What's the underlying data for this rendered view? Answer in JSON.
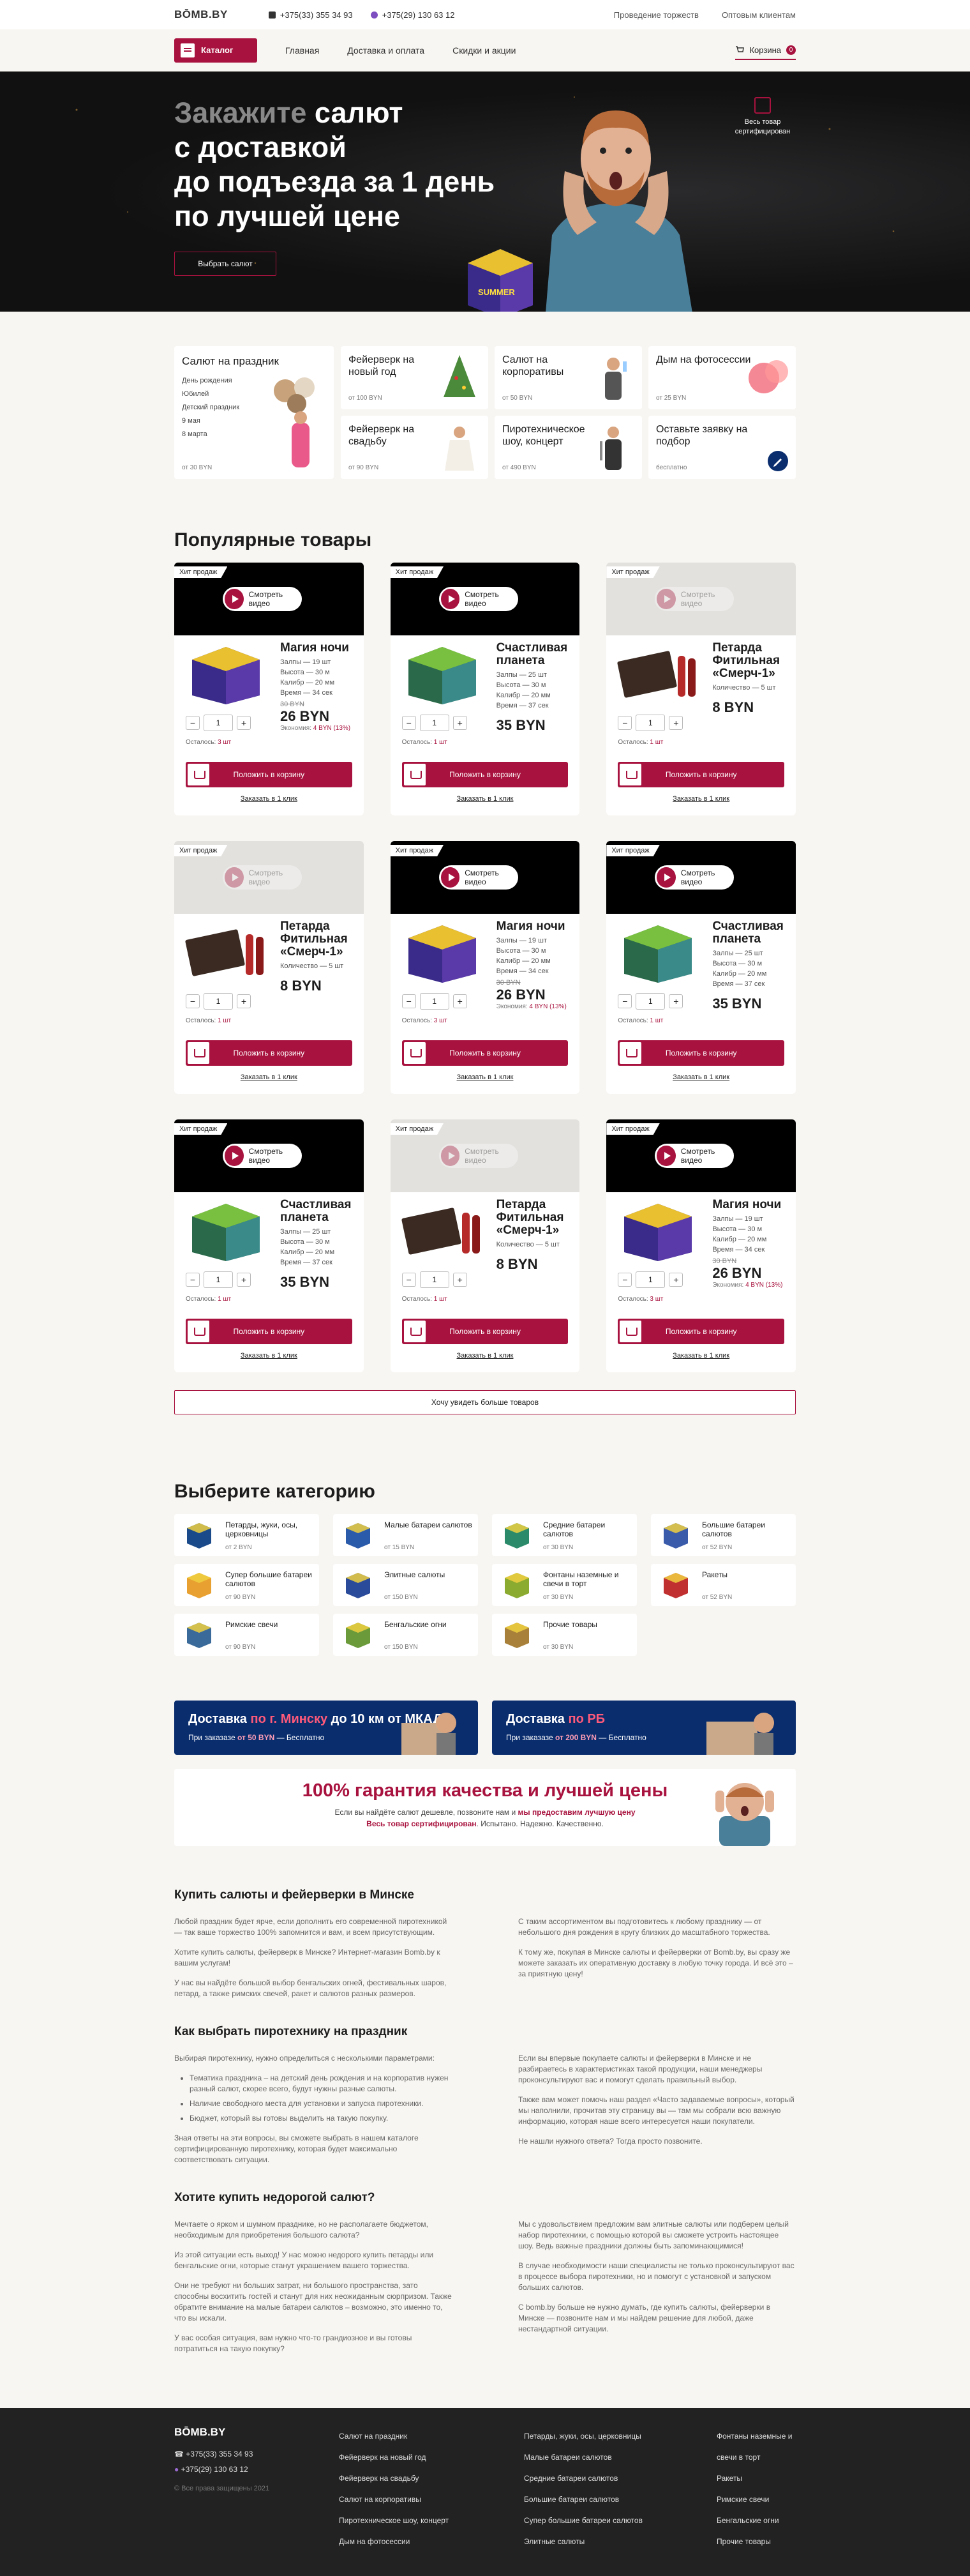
{
  "header": {
    "logo": "BŌMB.BY",
    "phone1": "+375(33) 355 34 93",
    "phone2": "+375(29) 130 63 12",
    "links": [
      "Проведение торжеств",
      "Оптовым клиентам"
    ]
  },
  "nav": {
    "catalog": "Каталог",
    "links": [
      "Главная",
      "Доставка и оплата",
      "Скидки и акции"
    ],
    "cart": "Корзина",
    "cart_count": "0"
  },
  "hero": {
    "title_grey": "Закажите",
    "title_rest": " салют",
    "line2": "с доставкой",
    "line3": "до подъезда за 1 день",
    "line4": "по лучшей цене",
    "button": "Выбрать салют",
    "cert": "Весь товар сертифицирован"
  },
  "occasions": {
    "big": {
      "title": "Салют на праздник",
      "items": [
        "День рождения",
        "Юбилей",
        "Детский праздник",
        "9 мая",
        "8 марта"
      ],
      "price": "от 30 BYN"
    },
    "cards": [
      {
        "title": "Фейерверк на новый год",
        "price": "от 100 BYN"
      },
      {
        "title": "Салют на корпоративы",
        "price": "от 50 BYN"
      },
      {
        "title": "Дым на фотосессии",
        "price": "от 25 BYN"
      },
      {
        "title": "Фейерверк на свадьбу",
        "price": "от 90 BYN"
      },
      {
        "title": "Пиротехническое шоу, концерт",
        "price": "от 490 BYN"
      },
      {
        "title": "Оставьте заявку на подбор",
        "price": "бесплатно"
      }
    ]
  },
  "popular": {
    "title": "Популярные товары",
    "hit": "Хит продаж",
    "video": "Смотреть видео",
    "left_label": "Осталось:",
    "add": "Положить в корзину",
    "oneclick": "Заказать в 1 клик",
    "qty": "1",
    "items": [
      {
        "name": "Магия ночи",
        "spec": [
          "Залпы — 19 шт",
          "Высота — 30 м",
          "Калибр — 20 мм",
          "Время — 34 сек"
        ],
        "old": "30 BYN",
        "price": "26 BYN",
        "econ_label": "Экономия:",
        "econ": "4 BYN (13%)",
        "left": "3 шт",
        "video": "dark"
      },
      {
        "name": "Счастливая планета",
        "spec": [
          "Залпы — 25 шт",
          "Высота — 30 м",
          "Калибр — 20 мм",
          "Время — 37 сек"
        ],
        "old": "",
        "price": "35 BYN",
        "econ_label": "",
        "econ": "",
        "left": "1 шт",
        "video": "dark"
      },
      {
        "name": "Петарда Фитильная «Смерч-1»",
        "spec": [
          "Количество — 5 шт"
        ],
        "old": "",
        "price": "8 BYN",
        "econ_label": "",
        "econ": "",
        "left": "1 шт",
        "video": "grey"
      },
      {
        "name": "Петарда Фитильная «Смерч-1»",
        "spec": [
          "Количество — 5 шт"
        ],
        "old": "",
        "price": "8 BYN",
        "econ_label": "",
        "econ": "",
        "left": "1 шт",
        "video": "grey"
      },
      {
        "name": "Магия ночи",
        "spec": [
          "Залпы — 19 шт",
          "Высота — 30 м",
          "Калибр — 20 мм",
          "Время — 34 сек"
        ],
        "old": "30 BYN",
        "price": "26 BYN",
        "econ_label": "Экономия:",
        "econ": "4 BYN (13%)",
        "left": "3 шт",
        "video": "dark"
      },
      {
        "name": "Счастливая планета",
        "spec": [
          "Залпы — 25 шт",
          "Высота — 30 м",
          "Калибр — 20 мм",
          "Время — 37 сек"
        ],
        "old": "",
        "price": "35 BYN",
        "econ_label": "",
        "econ": "",
        "left": "1 шт",
        "video": "dark"
      },
      {
        "name": "Счастливая планета",
        "spec": [
          "Залпы — 25 шт",
          "Высота — 30 м",
          "Калибр — 20 мм",
          "Время — 37 сек"
        ],
        "old": "",
        "price": "35 BYN",
        "econ_label": "",
        "econ": "",
        "left": "1 шт",
        "video": "dark"
      },
      {
        "name": "Петарда Фитильная «Смерч-1»",
        "spec": [
          "Количество — 5 шт"
        ],
        "old": "",
        "price": "8 BYN",
        "econ_label": "",
        "econ": "",
        "left": "1 шт",
        "video": "grey"
      },
      {
        "name": "Магия ночи",
        "spec": [
          "Залпы — 19 шт",
          "Высота — 30 м",
          "Калибр — 20 мм",
          "Время — 34 сек"
        ],
        "old": "30 BYN",
        "price": "26 BYN",
        "econ_label": "Экономия:",
        "econ": "4 BYN (13%)",
        "left": "3 шт",
        "video": "dark"
      }
    ],
    "more": "Хочу увидеть больше товаров"
  },
  "categories": {
    "title": "Выберите категорию",
    "items": [
      {
        "title": "Петарды, жуки, осы, церковницы",
        "price": "от 2 BYN"
      },
      {
        "title": "Малые батареи салютов",
        "price": "от 15 BYN"
      },
      {
        "title": "Средние батареи салютов",
        "price": "от 30 BYN"
      },
      {
        "title": "Большие батареи салютов",
        "price": "от 52 BYN"
      },
      {
        "title": "Супер большие батареи салютов",
        "price": "от 90 BYN"
      },
      {
        "title": "Элитные салюты",
        "price": "от 150 BYN"
      },
      {
        "title": "Фонтаны наземные и свечи в торт",
        "price": "от 30 BYN"
      },
      {
        "title": "Ракеты",
        "price": "от 52 BYN"
      },
      {
        "title": "Римские свечи",
        "price": "от 90 BYN"
      },
      {
        "title": "Бенгальские огни",
        "price": "от 150 BYN"
      },
      {
        "title": "Прочие товары",
        "price": "от 30 BYN"
      }
    ]
  },
  "delivery": [
    {
      "pre": "Доставка ",
      "hl": "по г. Минску",
      "post": " до 10 км от МКАД",
      "p1": "При заказазе ",
      "p2": "от 50 BYN",
      "p3": " — Бесплатно"
    },
    {
      "pre": "Доставка ",
      "hl": "по РБ",
      "post": "",
      "p1": "При заказазе ",
      "p2": "от 200 BYN",
      "p3": " — Бесплатно"
    }
  ],
  "guarantee": {
    "hl": "100% гарантия",
    "rest": " качества и лучшей цены",
    "l1a": "Если вы найдёте салют дешевле, позвоните нам и ",
    "l1b": "мы предоставим лучшую цену",
    "l2a": "Весь товар сертифицирован",
    "l2b": ". Испытано. Надежно. Качественно."
  },
  "seo": [
    {
      "title": "Купить салюты и фейерверки в Минске",
      "left": [
        "Любой праздник будет ярче, если дополнить его современной пиротехникой — так ваше торжество 100% запомнится и вам, и всем присутствующим.",
        "Хотите купить салюты, фейерверк в Минске? Интернет-магазин Bomb.by к вашим услугам!",
        "У нас вы найдёте большой выбор бенгальских огней, фестивальных шаров, петард, а также римских свечей, ракет и салютов разных размеров."
      ],
      "right": [
        "С таким ассортиментом вы подготовитесь к любому празднику — от небольшого дня рождения в кругу близких до масштабного торжества.",
        "К тому же, покупая в Минске салюты и фейерверки от Bomb.by, вы сразу же можете заказать их оперативную доставку в любую точку города. И всё это – за приятную цену!"
      ]
    },
    {
      "title": "Как выбрать пиротехнику на праздник",
      "left_intro": "Выбирая пиротехнику, нужно определиться с несколькими параметрами:",
      "list": [
        "Тематика праздника – на детский день рождения и на корпоратив нужен разный салют, скорее всего, будут нужны разные салюты.",
        "Наличие свободного места для установки и запуска пиротехники.",
        "Бюджет, который вы готовы выделить на такую покупку."
      ],
      "left_outro": "Зная ответы на эти вопросы, вы сможете выбрать в нашем каталоге сертифицированную пиротехнику, которая будет максимально соответствовать ситуации.",
      "right": [
        "Если вы впервые покупаете салюты и фейерверки в Минске и не разбираетесь в характеристиках такой продукции, наши менеджеры проконсультируют вас и помогут сделать правильный выбор.",
        "Также вам может помочь наш раздел «Часто задаваемые вопросы», который мы наполнили, прочитав эту страницу вы — там мы собрали всю важную информацию, которая наше всего интересуется наши покупатели.",
        "Не нашли нужного ответа? Тогда просто позвоните."
      ]
    },
    {
      "title": "Хотите купить недорогой салют?",
      "left": [
        "Мечтаете о ярком и шумном празднике, но не располагаете бюджетом, необходимым для приобретения большого салюта?",
        "Из этой ситуации есть выход! У нас можно недорого купить петарды или бенгальские огни, которые станут украшением вашего торжества.",
        "Они не требуют ни больших затрат, ни большого пространства, зато способны восхитить гостей и станут для них неожиданным сюрпризом. Также обратите внимание на малые батареи салютов – возможно, это именно то, что вы искали.",
        "У вас особая ситуация, вам нужно что-то грандиозное и вы готовы потратиться на такую покупку?"
      ],
      "right": [
        "Мы с удовольствием предложим вам элитные салюты или подберем целый набор пиротехники, с помощью которой вы сможете устроить настоящее шоу. Ведь важные праздники должны быть запоминающимися!",
        "В случае необходимости наши специалисты не только проконсультируют вас в процессе выбора пиротехники, но и помогут с установкой и запуском больших салютов.",
        "С bomb.by больше не нужно думать, где купить салюты, фейерверки в Минске — позвоните нам и мы найдем решение для любой, даже нестандартной ситуации."
      ]
    }
  ],
  "footer": {
    "logo": "BŌMB.BY",
    "phone1": "+375(33) 355 34 93",
    "phone2": "+375(29) 130 63 12",
    "copy": "© Все права защищены 2021",
    "col1": [
      "Салют на праздник",
      "Фейерверк на новый год",
      "Фейерверк на свадьбу",
      "Салют на корпоративы",
      "Пиротехническое шоу, концерт",
      "Дым на фотосессии"
    ],
    "col2": [
      "Петарды, жуки, осы, церковницы",
      "Малые батареи салютов",
      "Средние батареи салютов",
      "Большие батареи салютов",
      "Супер большие батареи салютов",
      "Элитные салюты"
    ],
    "col3": [
      "Фонтаны наземные и свечи в торт",
      "Ракеты",
      "Римские свечи",
      "Бенгальские огни",
      "Прочие товары"
    ]
  },
  "colors": {
    "accent": "#a8123e",
    "delivery_bg": "#0a2d6e",
    "hero_bg": "#111111"
  }
}
